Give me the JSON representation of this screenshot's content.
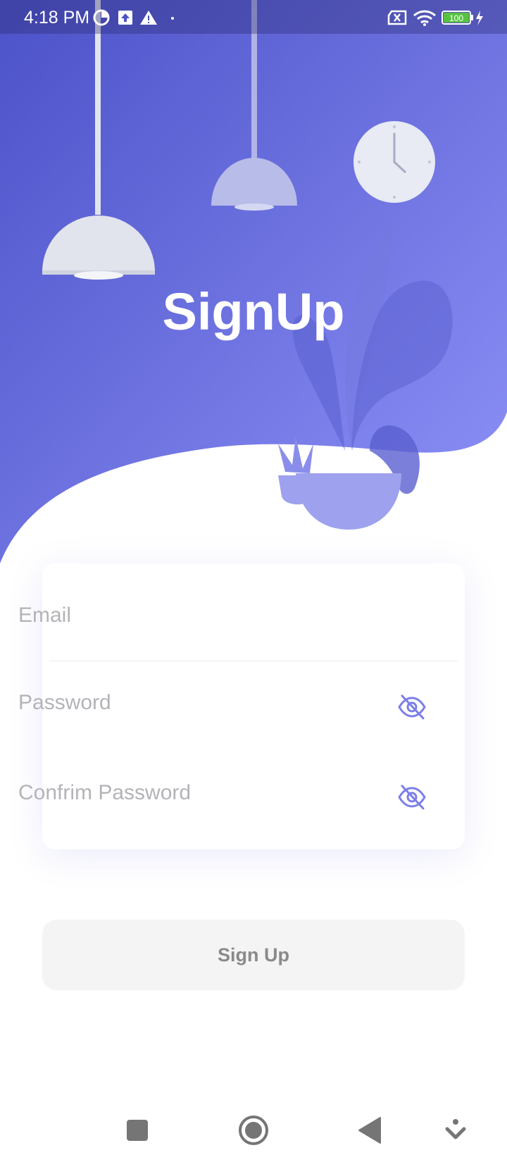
{
  "status_bar": {
    "time": "4:18 PM",
    "battery": "100"
  },
  "header": {
    "title": "SignUp"
  },
  "form": {
    "email_placeholder": "Email",
    "password_placeholder": "Password",
    "confirm_placeholder": "Confrim Password"
  },
  "actions": {
    "signup_label": "Sign Up"
  },
  "icons": {
    "hero_illustration": "lamps-clock-plant-illustration",
    "visibility_toggle": "eye-slash-icon",
    "nav": [
      "recents-icon",
      "home-icon",
      "back-icon",
      "accessibility-icon"
    ]
  },
  "colors": {
    "gradient_start": "#4C52C8",
    "gradient_end": "#8E92F8",
    "accent": "#7B7FE8",
    "button_bg": "#F4F4F4",
    "button_text": "#8A8A8A",
    "placeholder": "#B3B3B8"
  }
}
